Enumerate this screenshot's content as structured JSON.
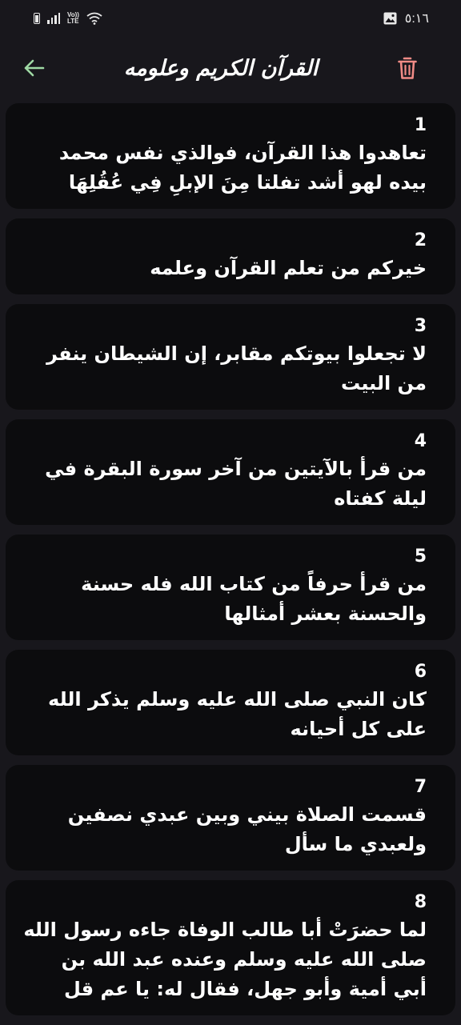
{
  "status_bar": {
    "time": "٥:١٦",
    "network_label_top": "Vo))",
    "network_label_bottom": "LTE",
    "icons": [
      "battery-icon",
      "signal-icon",
      "lte-icon",
      "wifi-icon",
      "gallery-icon"
    ]
  },
  "appbar": {
    "title": "القرآن الكريم وعلومه",
    "back_icon": "arrow-left-icon",
    "delete_icon": "trash-icon",
    "colors": {
      "back": "#9fd9a4",
      "delete": "#f08b86"
    }
  },
  "items": [
    {
      "number": "1",
      "text": "تعاهدوا هذا القرآن، فوالذي نفس محمد بيده لهو أشد تفلتا مِنَ الإبلِ فِي عُقُلِهَا"
    },
    {
      "number": "2",
      "text": "خيركم من تعلم القرآن وعلمه"
    },
    {
      "number": "3",
      "text": "لا تجعلوا بيوتكم مقابر، إن الشيطان ينفر من البيت"
    },
    {
      "number": "4",
      "text": "من قرأ بالآيتين من آخر سورة البقرة في ليلة كفتاه"
    },
    {
      "number": "5",
      "text": "من قرأ حرفاً من كتاب الله فله حسنة والحسنة بعشر أمثالها"
    },
    {
      "number": "6",
      "text": "كان النبي صلى الله عليه وسلم يذكر الله على كل أحيانه"
    },
    {
      "number": "7",
      "text": "قسمت الصلاة بيني وبين عبدي نصفين ولعبدي ما سأل"
    },
    {
      "number": "8",
      "text": "لما حضرَتْ أبا طالب الوفاة جاءه رسول الله صلى الله عليه وسلم وعنده عبد الله بن أبي أمية وأبو جهل، فقال له: يا عم قل"
    }
  ],
  "colors": {
    "background": "#18171c",
    "card": "#0c0c0e",
    "text": "#ffffff"
  }
}
